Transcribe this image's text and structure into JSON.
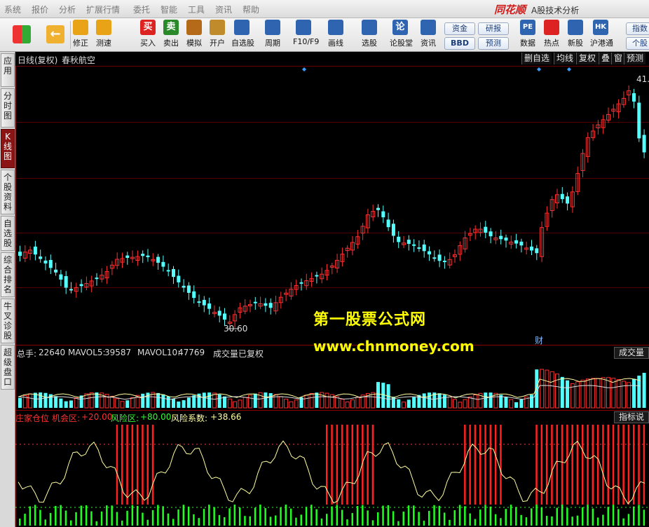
{
  "menu": [
    "系统",
    "报价",
    "分析",
    "扩展行情",
    "委托",
    "智能",
    "工具",
    "资讯",
    "帮助"
  ],
  "brand": {
    "logo": "同花顺",
    "product": "A股技术分析"
  },
  "toolbar": {
    "buttons": [
      {
        "label": "修正",
        "icon": "up-down-icon",
        "color": "#e8a317"
      },
      {
        "label": "测速",
        "icon": "speed-icon",
        "color": "#e8a317"
      },
      {
        "label": "买入",
        "icon": "buy-icon",
        "color": "#d22",
        "glyph": "买"
      },
      {
        "label": "卖出",
        "icon": "sell-icon",
        "color": "#2a8a2a",
        "glyph": "卖"
      },
      {
        "label": "模拟",
        "icon": "hammer-icon",
        "color": "#b56a1a"
      },
      {
        "label": "开户",
        "icon": "lock-icon",
        "color": "#c08b2b"
      },
      {
        "label": "自选股",
        "icon": "star-icon",
        "color": "#2e64b0"
      },
      {
        "label": "周期",
        "icon": "clock-icon",
        "color": "#2e64b0"
      },
      {
        "label": "F10/F9",
        "icon": "doc-icon",
        "color": "#2e64b0"
      },
      {
        "label": "画线",
        "icon": "pen-icon",
        "color": "#2e64b0"
      },
      {
        "label": "选股",
        "icon": "screen-icon",
        "color": "#2e64b0"
      },
      {
        "label": "论股堂",
        "icon": "chat-icon",
        "color": "#2e64b0",
        "glyph": "论"
      },
      {
        "label": "资讯",
        "icon": "news-icon",
        "color": "#2e64b0"
      },
      {
        "label": "数据",
        "icon": "pe-icon",
        "color": "#2e64b0",
        "glyph": "PE"
      },
      {
        "label": "热点",
        "icon": "hot-icon",
        "color": "#d22"
      },
      {
        "label": "新股",
        "icon": "new-stock-icon",
        "color": "#2e64b0"
      },
      {
        "label": "沪港通",
        "icon": "hk-icon",
        "color": "#2e64b0",
        "glyph": "HK"
      }
    ],
    "small_buttons": [
      "资金",
      "研报",
      "BBD",
      "预测"
    ],
    "right_buttons": [
      "指数",
      "个股"
    ]
  },
  "sidebar": [
    "应用",
    "分时图",
    "K线图",
    "个股资料",
    "自选股",
    "综合排名",
    "牛叉诊股",
    "超级盘口"
  ],
  "chart": {
    "period_label": "日线(复权)",
    "stock_name": "春秋航空",
    "right_buttons": [
      "删自选",
      "均线",
      "复权",
      "叠",
      "窗",
      "预测"
    ],
    "high_marker": "41.",
    "low_marker": "30.60",
    "cai_marker": "财"
  },
  "volume": {
    "label": "总手:",
    "value": "22640",
    "ma5_label": "MAVOL5:",
    "ma5": "39587",
    "ma10_label": "MAVOL10:",
    "ma10": "47769",
    "note": "成交量已复权",
    "badge": "成交量"
  },
  "indicator": {
    "name": "庄家仓位",
    "zone1_label": "机会区:",
    "zone1": "+20.00",
    "zone2_label": "风险区:",
    "zone2": "+80.00",
    "coef_label": "风险系数:",
    "coef": "+38.66",
    "badge": "指标说"
  },
  "watermark": {
    "line1": "第一股票公式网",
    "line2": "www.chnmoney.com"
  },
  "colors": {
    "up": "#ff3030",
    "down": "#54ffff",
    "grid": "#8b0000",
    "ma": "#ffffa0",
    "watermark": "#ffff00"
  }
}
